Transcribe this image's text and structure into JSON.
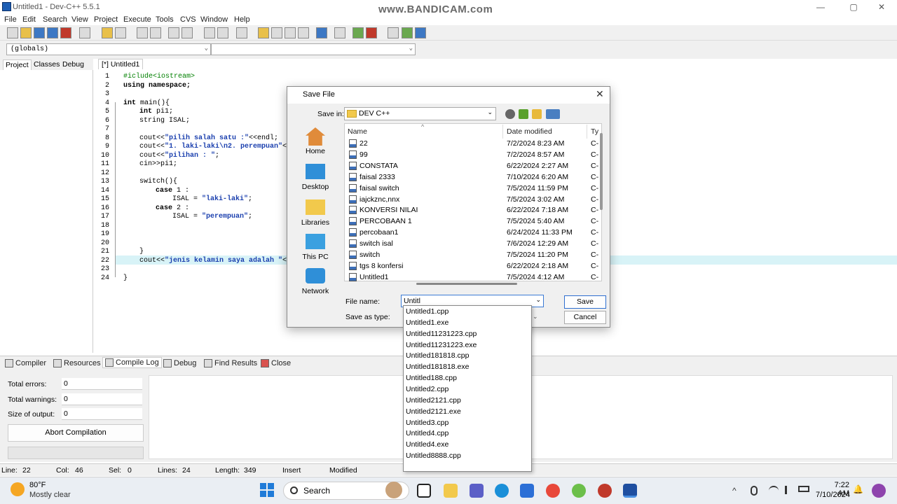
{
  "window": {
    "title": "Untitled1 - Dev-C++ 5.5.1",
    "watermark": "www.BANDICAM.com",
    "controls": {
      "minimize": "—",
      "maximize": "▢",
      "close": "✕"
    }
  },
  "menu": [
    "File",
    "Edit",
    "Search",
    "View",
    "Project",
    "Execute",
    "Tools",
    "CVS",
    "Window",
    "Help"
  ],
  "scope_combo": {
    "value": "(globals)",
    "arrow": "⌄"
  },
  "left_tabs": [
    "Project",
    "Classes",
    "Debug"
  ],
  "editor_tab": "[*] Untitled1",
  "code": {
    "line_numbers": [
      "1",
      "2",
      "3",
      "4",
      "5",
      "6",
      "7",
      "8",
      "9",
      "10",
      "11",
      "12",
      "13",
      "14",
      "15",
      "16",
      "17",
      "18",
      "19",
      "20",
      "21",
      "22",
      "23",
      "24"
    ],
    "l1": "#iclude<iostream>",
    "l2": "using namespace;",
    "l4a": "int",
    "l4b": " main(){",
    "l5a": "int",
    "l5b": " pi1;",
    "l6": "string ISAL;",
    "l8a": "cout<<",
    "l8b": "\"pilih salah satu :\"",
    "l8c": "<<endl;",
    "l9a": "cout<<",
    "l9b": "\"1. laki-laki\\n2. perempuan\"",
    "l9c": "<<",
    "l10a": "cout<<",
    "l10b": "\"pilihan : \"",
    "l10c": ";",
    "l11": "cin>>pi1;",
    "l13": "switch(){",
    "l14a": "case",
    "l14b": " 1 :",
    "l15a": "ISAL = ",
    "l15b": "\"laki-laki\"",
    "l15c": ";",
    "l16a": "case",
    "l16b": " 2 :",
    "l17a": "ISAL = ",
    "l17b": "\"perempuan\"",
    "l17c": ";",
    "l21": "}",
    "l22a": "cout<<",
    "l22b": "\"jenis kelamin saya adalah \"",
    "l22c": "<<",
    "l24": "}"
  },
  "bottom_tabs": [
    "Compiler",
    "Resources",
    "Compile Log",
    "Debug",
    "Find Results",
    "Close"
  ],
  "compile": {
    "total_errors_label": "Total errors:",
    "total_errors": "0",
    "total_warnings_label": "Total warnings:",
    "total_warnings": "0",
    "size_label": "Size of output:",
    "size": "0",
    "abort_label": "Abort Compilation"
  },
  "status": {
    "line_label": "Line:",
    "line": "22",
    "col_label": "Col:",
    "col": "46",
    "sel_label": "Sel:",
    "sel": "0",
    "lines_label": "Lines:",
    "lines": "24",
    "length_label": "Length:",
    "length": "349",
    "mode": "Insert",
    "modified": "Modified"
  },
  "dialog": {
    "title": "Save File",
    "close": "✕",
    "save_in_label": "Save in:",
    "save_in_value": "DEV C++",
    "places": [
      "Home",
      "Desktop",
      "Libraries",
      "This PC",
      "Network"
    ],
    "columns": {
      "name": "Name",
      "date": "Date modified",
      "type": "Ty"
    },
    "files": [
      {
        "name": "22",
        "date": "7/2/2024 8:23 AM",
        "type": "C-"
      },
      {
        "name": "99",
        "date": "7/2/2024 8:57 AM",
        "type": "C-"
      },
      {
        "name": "CONSTATA",
        "date": "6/22/2024 2:27 AM",
        "type": "C-"
      },
      {
        "name": "faisal 2333",
        "date": "7/10/2024 6:20 AM",
        "type": "C-"
      },
      {
        "name": "faisal switch",
        "date": "7/5/2024 11:59 PM",
        "type": "C-"
      },
      {
        "name": "iajckznc,nnx",
        "date": "7/5/2024 3:02 AM",
        "type": "C-"
      },
      {
        "name": "KONVERSI NILAI",
        "date": "6/22/2024 7:18 AM",
        "type": "C-"
      },
      {
        "name": "PERCOBAAN 1",
        "date": "7/5/2024 5:40 AM",
        "type": "C-"
      },
      {
        "name": "percobaan1",
        "date": "6/24/2024 11:33 PM",
        "type": "C-"
      },
      {
        "name": "switch isal",
        "date": "7/6/2024 12:29 AM",
        "type": "C-"
      },
      {
        "name": "switch",
        "date": "7/5/2024 11:20 PM",
        "type": "C-"
      },
      {
        "name": "tgs 8 konfersi",
        "date": "6/22/2024 2:18 AM",
        "type": "C-"
      },
      {
        "name": "Untitled1",
        "date": "7/5/2024 4:12 AM",
        "type": "C-"
      }
    ],
    "file_name_label": "File name:",
    "file_name_value": "Untitl",
    "save_as_type_label": "Save as type:",
    "save_button": "Save",
    "cancel_button": "Cancel",
    "autocomplete": [
      "Untitled1.cpp",
      "Untitled1.exe",
      "Untitled11231223.cpp",
      "Untitled11231223.exe",
      "Untitled181818.cpp",
      "Untitled181818.exe",
      "Untitled188.cpp",
      "Untitled2.cpp",
      "Untitled2121.cpp",
      "Untitled2121.exe",
      "Untitled3.cpp",
      "Untitled4.cpp",
      "Untitled4.exe",
      "Untitled8888.cpp"
    ]
  },
  "taskbar": {
    "weather_temp": "80°F",
    "weather_desc": "Mostly clear",
    "search_placeholder": "Search",
    "time": "7:22 AM",
    "date": "7/10/2024",
    "tray": {
      "chevron": "^",
      "bell": "🔔"
    }
  },
  "colors": {
    "accent": "#3b7bd4",
    "current_line": "#d8f3f7",
    "string": "#1a3fae",
    "include": "#008000"
  }
}
